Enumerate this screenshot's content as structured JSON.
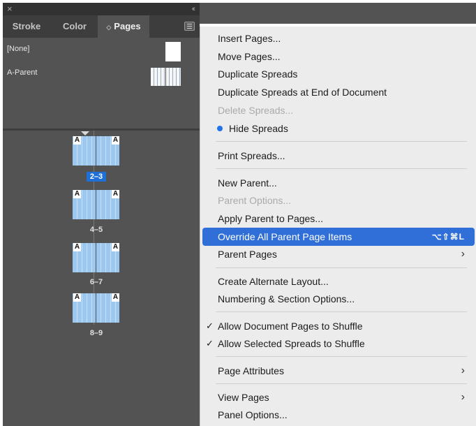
{
  "panel": {
    "close_glyph": "×",
    "collapse_glyph": "‹‹",
    "tabs": [
      {
        "label": "Stroke"
      },
      {
        "label": "Color"
      },
      {
        "label": "Pages",
        "arrows": "◇"
      }
    ],
    "parents": [
      {
        "label": "[None]"
      },
      {
        "label": "A-Parent"
      }
    ],
    "spreads": [
      {
        "label": "2–3",
        "selected": true
      },
      {
        "label": "4–5"
      },
      {
        "label": "6–7"
      },
      {
        "label": "8–9"
      }
    ],
    "parent_mark": "A",
    "colors": {
      "panel": "#535353",
      "page_blue": "#9cc7ef",
      "selection": "#1f6fd6"
    }
  },
  "menu": {
    "items": [
      {
        "label": "Insert Pages..."
      },
      {
        "label": "Move Pages..."
      },
      {
        "label": "Duplicate Spreads"
      },
      {
        "label": "Duplicate Spreads at End of Document"
      },
      {
        "label": "Delete Spreads...",
        "disabled": true
      },
      {
        "label": "Hide Spreads",
        "bullet": true
      },
      {
        "label": "Print Spreads..."
      },
      {
        "label": "New Parent..."
      },
      {
        "label": "Parent Options...",
        "disabled": true
      },
      {
        "label": "Apply Parent to Pages..."
      },
      {
        "label": "Override All Parent Page Items",
        "highlighted": true,
        "shortcut": "⌥⇧⌘L"
      },
      {
        "label": "Parent Pages",
        "submenu": true
      },
      {
        "label": "Create Alternate Layout..."
      },
      {
        "label": "Numbering & Section Options..."
      },
      {
        "label": "Allow Document Pages to Shuffle",
        "checked": true
      },
      {
        "label": "Allow Selected Spreads to Shuffle",
        "checked": true
      },
      {
        "label": "Page Attributes",
        "submenu": true
      },
      {
        "label": "View Pages",
        "submenu": true
      },
      {
        "label": "Panel Options..."
      }
    ],
    "check_glyph": "✓",
    "submenu_glyph": "›",
    "colors": {
      "highlight": "#2f6fd7",
      "bullet": "#1f72e8"
    }
  }
}
